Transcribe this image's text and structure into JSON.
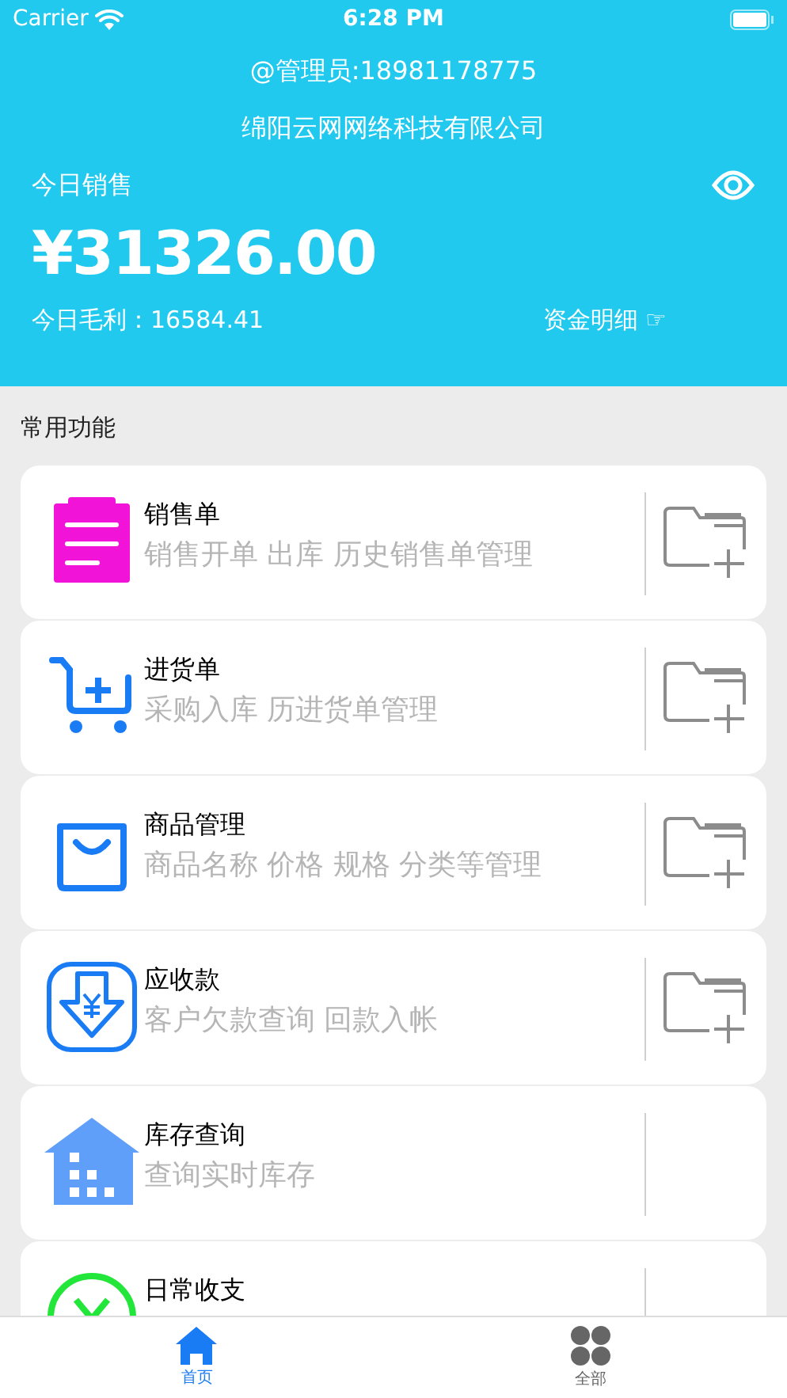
{
  "status_bar": {
    "carrier": "Carrier",
    "time": "6:28 PM"
  },
  "header": {
    "account": "@管理员:18981178775",
    "company": "绵阳云网网络科技有限公司",
    "sales_label": "今日销售",
    "sales_amount": "¥31326.00",
    "profit": "今日毛利：16584.41",
    "funds_link": "资金明细",
    "funds_pointer": "☞"
  },
  "section_title": "常用功能",
  "features": [
    {
      "kind": "clipboard",
      "title": "销售单",
      "subtitle": "销售开单 出库 历史销售单管理",
      "quick_add": true
    },
    {
      "kind": "cart",
      "title": "进货单",
      "subtitle": "采购入库 历进货单管理",
      "quick_add": true
    },
    {
      "kind": "bag",
      "title": "商品管理",
      "subtitle": "商品名称 价格 规格 分类等管理",
      "quick_add": true
    },
    {
      "kind": "receivable",
      "title": "应收款",
      "subtitle": "客户欠款查询 回款入帐",
      "quick_add": true
    },
    {
      "kind": "warehouse",
      "title": "库存查询",
      "subtitle": "查询实时库存",
      "quick_add": false
    },
    {
      "kind": "ledger",
      "title": "日常收支",
      "quick_add": false
    }
  ],
  "tab_bar": [
    {
      "kind": "home",
      "label": "首页",
      "selected": true
    },
    {
      "kind": "all",
      "label": "全部",
      "selected": false
    }
  ]
}
